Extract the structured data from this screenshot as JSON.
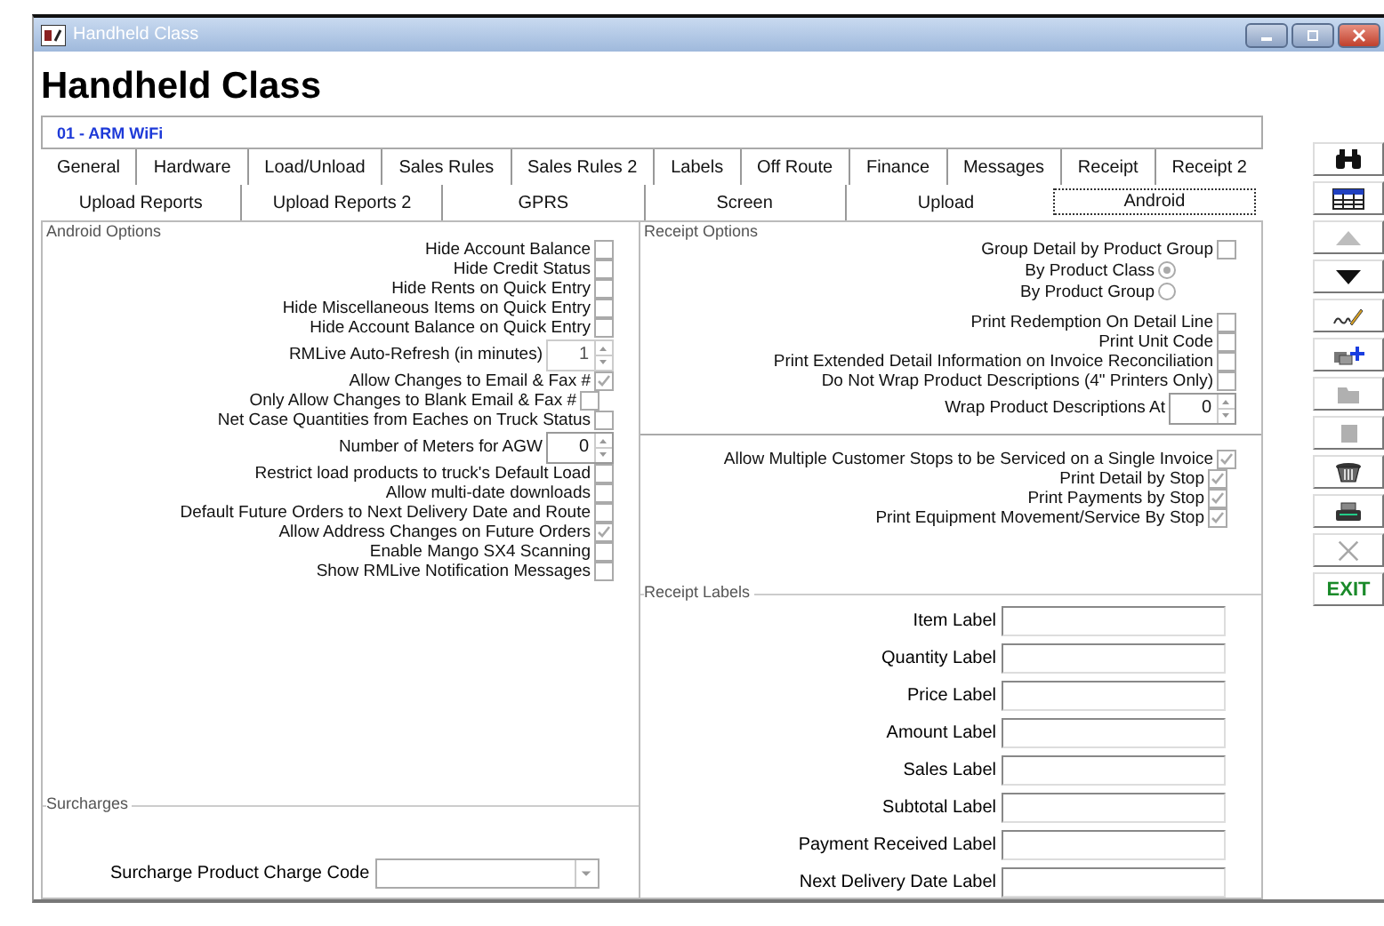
{
  "window": {
    "title": "Handheld Class"
  },
  "heading": "Handheld Class",
  "record": "01 - ARM WiFi",
  "tabs": [
    [
      {
        "label": "General",
        "selected": false
      },
      {
        "label": "Hardware",
        "selected": false
      },
      {
        "label": "Load/Unload",
        "selected": false
      },
      {
        "label": "Sales Rules",
        "selected": false
      },
      {
        "label": "Sales Rules 2",
        "selected": false
      },
      {
        "label": "Labels",
        "selected": false
      },
      {
        "label": "Off Route",
        "selected": false
      },
      {
        "label": "Finance",
        "selected": false
      },
      {
        "label": "Messages",
        "selected": false
      },
      {
        "label": "Receipt",
        "selected": false
      },
      {
        "label": "Receipt 2",
        "selected": false
      }
    ],
    [
      {
        "label": "Upload Reports",
        "selected": false
      },
      {
        "label": "Upload Reports 2",
        "selected": false
      },
      {
        "label": "GPRS",
        "selected": false
      },
      {
        "label": "Screen",
        "selected": false
      },
      {
        "label": "Upload",
        "selected": false
      },
      {
        "label": "Android",
        "selected": true
      }
    ]
  ],
  "android_options": {
    "legend": "Android Options",
    "items": [
      {
        "kind": "checkbox",
        "label": "Hide Account Balance",
        "checked": false
      },
      {
        "kind": "checkbox",
        "label": "Hide Credit Status",
        "checked": false
      },
      {
        "kind": "checkbox",
        "label": "Hide Rents on Quick Entry",
        "checked": false
      },
      {
        "kind": "checkbox",
        "label": "Hide Miscellaneous Items on Quick Entry",
        "checked": false
      },
      {
        "kind": "checkbox",
        "label": "Hide Account Balance on Quick Entry",
        "checked": false
      },
      {
        "kind": "spin",
        "label": "RMLive Auto-Refresh (in minutes)",
        "value": "1",
        "disabled": true
      },
      {
        "kind": "checkbox",
        "label": "Allow Changes to Email & Fax #",
        "checked": true
      },
      {
        "kind": "checkbox",
        "label": "Only Allow Changes to Blank Email & Fax #",
        "checked": false
      },
      {
        "kind": "checkbox",
        "label": "Net Case Quantities from Eaches on Truck Status",
        "checked": false
      },
      {
        "kind": "spin",
        "label": "Number of Meters for AGW",
        "value": "0",
        "disabled": false
      },
      {
        "kind": "checkbox",
        "label": "Restrict load products to truck's Default Load",
        "checked": false
      },
      {
        "kind": "checkbox",
        "label": "Allow multi-date downloads",
        "checked": false
      },
      {
        "kind": "checkbox",
        "label": "Default Future Orders to Next Delivery Date and Route",
        "checked": false
      },
      {
        "kind": "checkbox",
        "label": "Allow Address Changes on Future Orders",
        "checked": true
      },
      {
        "kind": "checkbox",
        "label": "Enable Mango SX4 Scanning",
        "checked": false
      },
      {
        "kind": "checkbox",
        "label": "Show RMLive Notification Messages",
        "checked": false
      }
    ]
  },
  "surcharges": {
    "legend": "Surcharges",
    "label": "Surcharge Product Charge Code"
  },
  "receipt_options": {
    "legend": "Receipt Options",
    "items": [
      {
        "kind": "checkbox",
        "label": "Group Detail by Product Group",
        "checked": false
      },
      {
        "kind": "radio",
        "label": "By Product Class",
        "selected": true
      },
      {
        "kind": "radio",
        "label": "By Product Group",
        "selected": false
      },
      {
        "kind": "checkbox",
        "label": "Print Redemption On Detail Line",
        "checked": false
      },
      {
        "kind": "checkbox",
        "label": "Print Unit Code",
        "checked": false
      },
      {
        "kind": "checkbox",
        "label": "Print Extended Detail Information on Invoice Reconciliation",
        "checked": false
      },
      {
        "kind": "checkbox",
        "label": "Do Not Wrap Product Descriptions (4\" Printers Only)",
        "checked": false
      },
      {
        "kind": "spin",
        "label": "Wrap Product Descriptions At",
        "value": "0"
      }
    ],
    "stop_items": [
      {
        "kind": "checkbox",
        "label": "Allow Multiple Customer Stops to be Serviced on a Single Invoice",
        "checked": true
      },
      {
        "kind": "subcheckbox",
        "label": "Print Detail by Stop",
        "checked": true
      },
      {
        "kind": "subcheckbox",
        "label": "Print Payments by Stop",
        "checked": true
      },
      {
        "kind": "subcheckbox",
        "label": "Print Equipment Movement/Service By Stop",
        "checked": true
      }
    ]
  },
  "receipt_labels": {
    "legend": "Receipt Labels",
    "fields": [
      {
        "label": "Item Label"
      },
      {
        "label": "Quantity Label"
      },
      {
        "label": "Price Label"
      },
      {
        "label": "Amount Label"
      },
      {
        "label": "Sales Label"
      },
      {
        "label": "Subtotal Label"
      },
      {
        "label": "Payment Received Label"
      },
      {
        "label": "Next Delivery Date Label"
      }
    ]
  },
  "toolbar": [
    {
      "kind": "search",
      "disabled": false
    },
    {
      "kind": "grid",
      "disabled": false
    },
    {
      "kind": "up",
      "disabled": true
    },
    {
      "kind": "down",
      "disabled": false
    },
    {
      "kind": "sign",
      "disabled": false
    },
    {
      "kind": "add",
      "disabled": false
    },
    {
      "kind": "folder",
      "disabled": true
    },
    {
      "kind": "stop",
      "disabled": true
    },
    {
      "kind": "trash",
      "disabled": false
    },
    {
      "kind": "print",
      "disabled": false
    },
    {
      "kind": "close",
      "disabled": true
    },
    {
      "kind": "exit",
      "label": "EXIT",
      "disabled": false
    }
  ]
}
